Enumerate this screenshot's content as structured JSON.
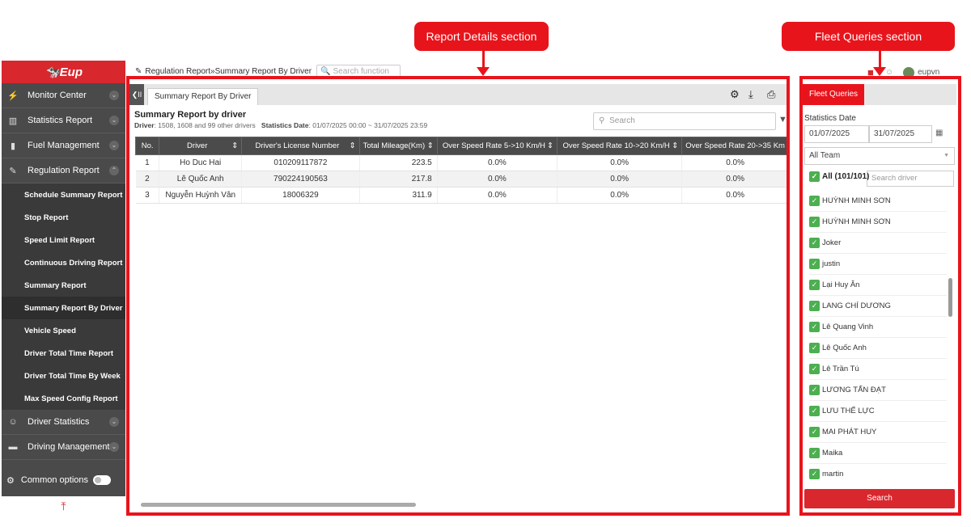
{
  "annotations": {
    "report_section": "Report Details section",
    "fleet_section": "Fleet Queries section"
  },
  "brand": {
    "logo_text": "Eup",
    "accent": "#d9272e"
  },
  "sidebar": {
    "items": [
      {
        "label": "Monitor Center",
        "icon": "monitor-icon"
      },
      {
        "label": "Statistics Report",
        "icon": "chart-icon"
      },
      {
        "label": "Fuel Management",
        "icon": "fuel-icon"
      },
      {
        "label": "Regulation Report",
        "icon": "regulation-icon"
      }
    ],
    "sub_items": [
      "Schedule Summary Report",
      "Stop Report",
      "Speed Limit Report",
      "Continuous Driving Report",
      "Summary Report",
      "Summary Report By Driver",
      "Vehicle Speed",
      "Driver Total Time Report",
      "Driver Total Time By Week",
      "Max Speed Config Report"
    ],
    "bottom_items": [
      {
        "label": "Driver Statistics",
        "icon": "driver-icon"
      },
      {
        "label": "Driving Management",
        "icon": "briefcase-icon"
      }
    ],
    "common_options": "Common options"
  },
  "breadcrumb": {
    "parent": "Regulation Report",
    "sep": " » ",
    "current": "Summary Report By Driver",
    "search_placeholder": "Search function"
  },
  "user": {
    "name": "eupvn"
  },
  "report": {
    "tab_label": "Summary Report By Driver",
    "title": "Summary Report by driver",
    "driver_label": "Driver",
    "driver_value": ": 1508, 1608 and 99 other drivers",
    "date_label": "Statistics Date",
    "date_value": ": 01/07/2025 00:00 ~ 31/07/2025 23:59",
    "search_placeholder": "Search",
    "columns": [
      "No.",
      "Driver",
      "Driver's License Number",
      "Total Mileage(Km)",
      "Over Speed Rate 5->10 Km/H",
      "Over Speed Rate 10->20 Km/H",
      "Over Speed Rate 20->35 Km"
    ],
    "rows": [
      [
        "1",
        "Ho Duc Hai",
        "010209117872",
        "223.5",
        "0.0%",
        "0.0%",
        "0.0%"
      ],
      [
        "2",
        "Lê Quốc Anh",
        "790224190563",
        "217.8",
        "0.0%",
        "0.0%",
        "0.0%"
      ],
      [
        "3",
        "Nguyễn Huỳnh Vân",
        "18006329",
        "311.9",
        "0.0%",
        "0.0%",
        "0.0%"
      ]
    ]
  },
  "fleet": {
    "tab_label": "Fleet Queries",
    "stat_label": "Statistics Date",
    "date_from": "01/07/2025",
    "date_to": "31/07/2025",
    "team": "All Team",
    "all_label": "All (101/101)",
    "driver_search_placeholder": "Search driver",
    "drivers": [
      "HUỲNH MINH SƠN",
      "HUỲNH MINH SƠN",
      "Joker",
      "justin",
      "Lại Huy Ân",
      "LANG CHÍ DƯƠNG",
      "Lê Quang Vinh",
      "Lê Quốc Anh",
      "Lê Trần Tú",
      "LƯƠNG TẤN ĐẠT",
      "LƯU THỂ LỰC",
      "MAI PHÁT HUY",
      "Maika",
      "martin"
    ],
    "search_button": "Search"
  }
}
